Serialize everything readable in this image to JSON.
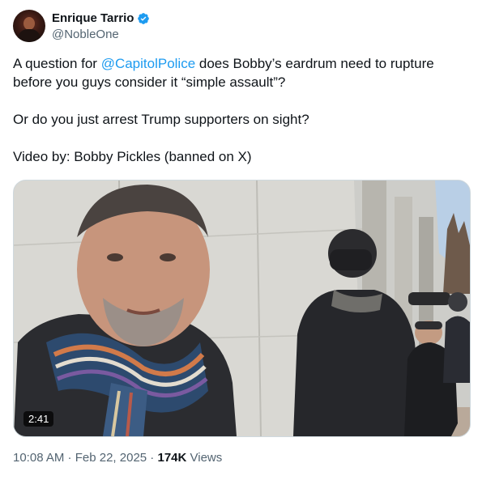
{
  "author": {
    "display_name": "Enrique Tarrio",
    "handle": "@NobleOne",
    "verified": true
  },
  "tweet": {
    "line1_before": "A question for ",
    "mention": "@CapitolPolice",
    "line1_after": " does Bobby’s eardrum need to rupture before you guys consider it “simple assault”?",
    "paragraph2": "Or do you just arrest Trump supporters on sight?",
    "paragraph3": "Video by: Bobby Pickles (banned on X)"
  },
  "media": {
    "duration": "2:41"
  },
  "meta": {
    "time": "10:08 AM",
    "separator": " · ",
    "date": "Feb 22, 2025",
    "views_count": "174K",
    "views_label": " Views"
  },
  "colors": {
    "link": "#1d9bf0",
    "verified_badge": "#1d9bf0",
    "secondary_text": "#536471"
  }
}
